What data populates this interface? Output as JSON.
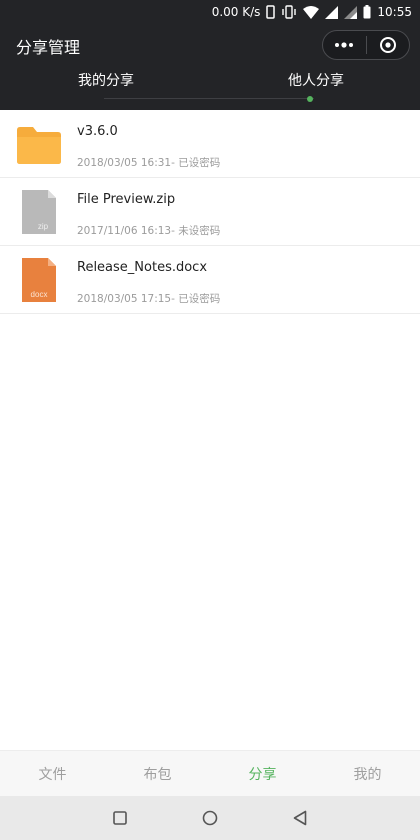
{
  "status_bar": {
    "network_speed": "0.00 K/s",
    "time": "10:55"
  },
  "header": {
    "title": "分享管理",
    "tabs": [
      {
        "label": "我的分享",
        "active": false
      },
      {
        "label": "他人分享",
        "active": true
      }
    ]
  },
  "files": [
    {
      "name": "v3.6.0",
      "meta": "2018/03/05 16:31- 已设密码",
      "icon": "folder-icon",
      "icon_text": ""
    },
    {
      "name": "File Preview.zip",
      "meta": "2017/11/06 16:13- 未设密码",
      "icon": "zip-file-icon",
      "icon_text": "zip"
    },
    {
      "name": "Release_Notes.docx",
      "meta": "2018/03/05 17:15- 已设密码",
      "icon": "docx-file-icon",
      "icon_text": "docx"
    }
  ],
  "tabbar": {
    "items": [
      {
        "label": "文件",
        "active": false
      },
      {
        "label": "布包",
        "active": false
      },
      {
        "label": "分享",
        "active": true
      },
      {
        "label": "我的",
        "active": false
      }
    ]
  },
  "colors": {
    "header_bg": "#232427",
    "accent": "#55b35e",
    "folder": "#f6ac3c",
    "zip": "#b9b9b9",
    "docx": "#e8813e"
  }
}
